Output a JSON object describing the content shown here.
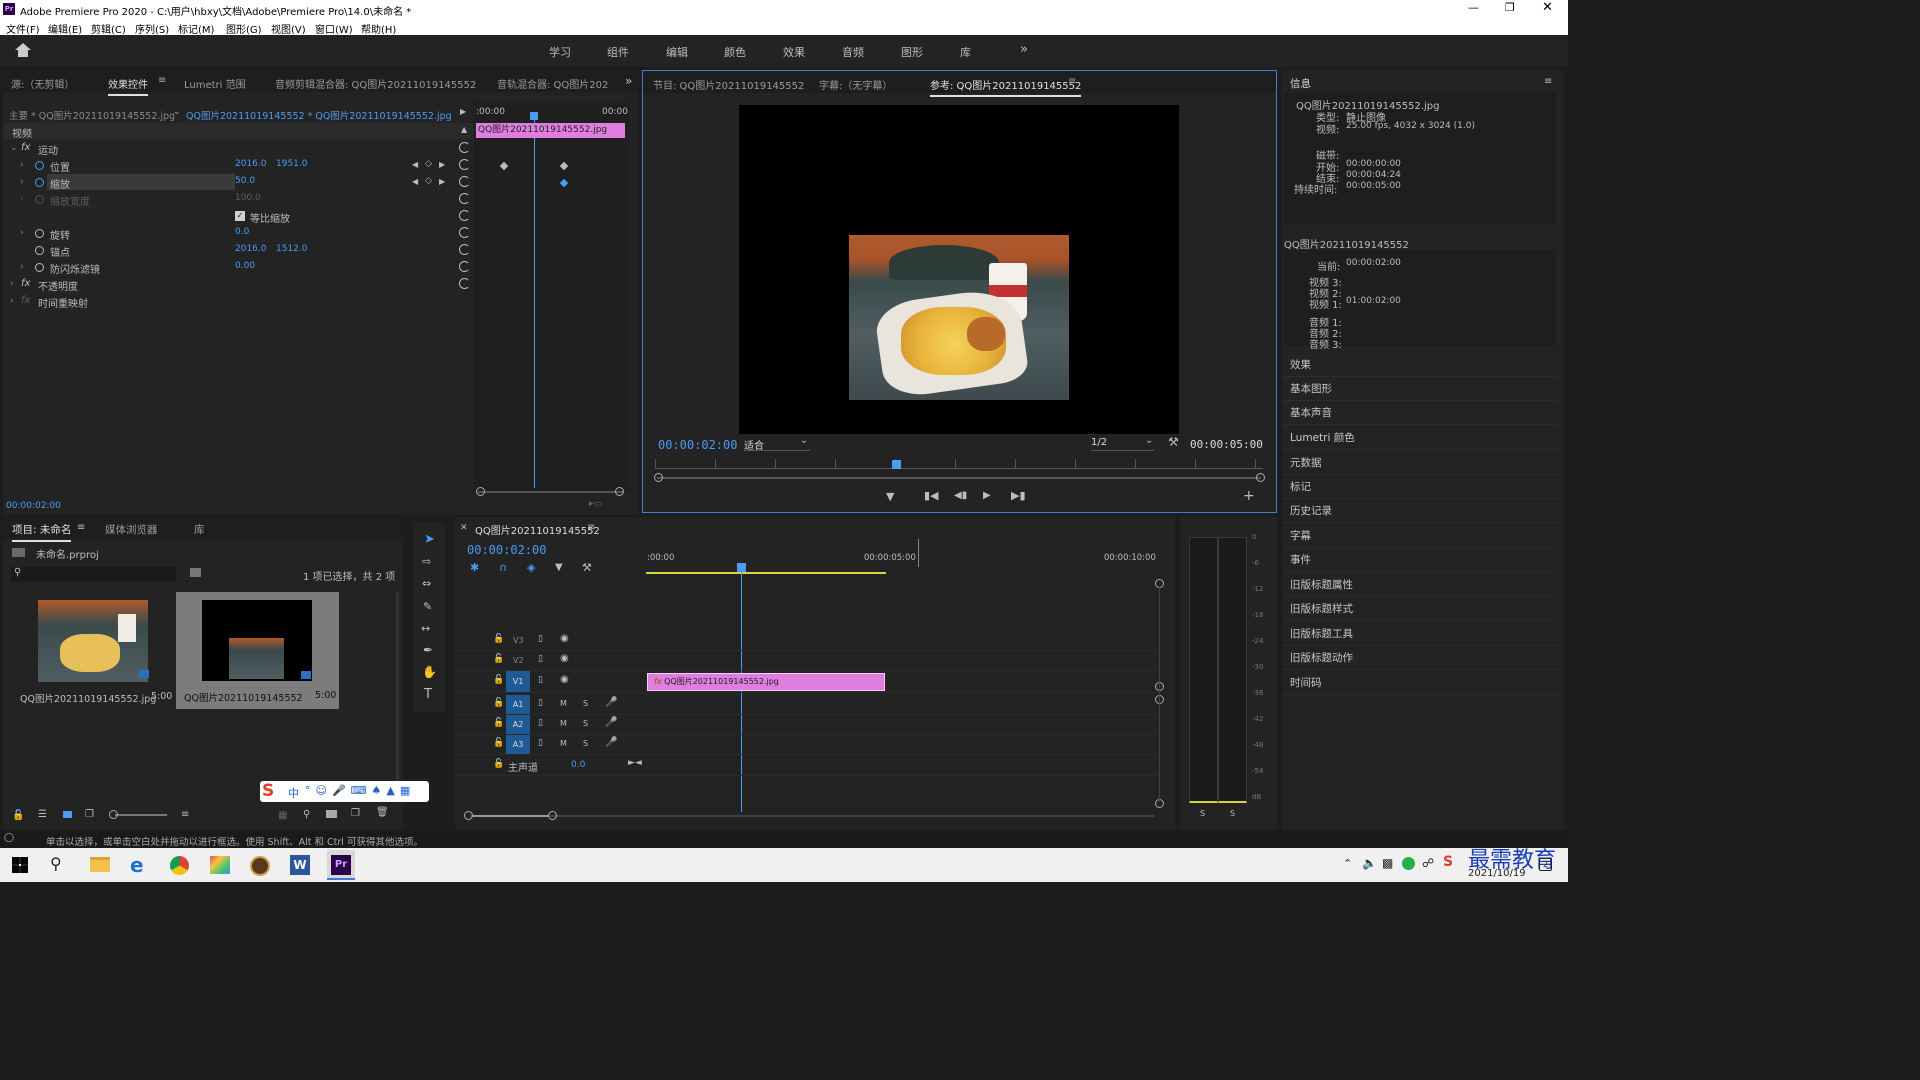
{
  "titlebar": {
    "title": "Adobe Premiere Pro 2020 - C:\\用户\\hbxy\\文档\\Adobe\\Premiere Pro\\14.0\\未命名 *",
    "logo": "Pr"
  },
  "menu": [
    "文件(F)",
    "编辑(E)",
    "剪辑(C)",
    "序列(S)",
    "标记(M)",
    "图形(G)",
    "视图(V)",
    "窗口(W)",
    "帮助(H)"
  ],
  "workspaces": [
    "学习",
    "组件",
    "编辑",
    "颜色",
    "效果",
    "音频",
    "图形",
    "库"
  ],
  "source_panel": {
    "tabs": [
      "源:（无剪辑）",
      "效果控件",
      "Lumetri 范围",
      "音频剪辑混合器: QQ图片20211019145552",
      "音轨混合器: QQ图片202"
    ],
    "active_tab": 1,
    "clip_master": "主要 * QQ图片20211019145552.jpg",
    "clip_seq": "QQ图片20211019145552 * QQ图片20211019145552.jpg",
    "mini_time_start": ":00:00",
    "mini_time_end": "00:00",
    "mini_clip": "QQ图片20211019145552.jpg",
    "section_video": "视频",
    "fx_motion": "运动",
    "position_label": "位置",
    "position_x": "2016.0",
    "position_y": "1951.0",
    "scale_label": "缩放",
    "scale_value": "50.0",
    "scale_width_label": "缩放宽度",
    "scale_width_value": "100.0",
    "uniform_label": "等比缩放",
    "rotation_label": "旋转",
    "rotation_value": "0.0",
    "anchor_label": "锚点",
    "anchor_x": "2016.0",
    "anchor_y": "1512.0",
    "flicker_label": "防闪烁滤镜",
    "flicker_value": "0.00",
    "opacity_label": "不透明度",
    "timeremap_label": "时间重映射",
    "timecode": "00:00:02:00"
  },
  "program_panel": {
    "tabs": [
      "节目: QQ图片20211019145552",
      "字幕:（无字幕）",
      "参考: QQ图片20211019145552"
    ],
    "active_tab": 2,
    "timecode": "00:00:02:00",
    "fit": "适合",
    "resolution": "1/2",
    "duration": "00:00:05:00"
  },
  "info_panel": {
    "title": "信息",
    "file": "QQ图片20211019145552.jpg",
    "type_label": "类型:",
    "type_value": "静止图像",
    "video_label": "视频:",
    "video_value": "25.00 fps, 4032 x 3024 (1.0)",
    "tape_label": "磁带:",
    "start_label": "开始:",
    "start_value": "00:00:00:00",
    "end_label": "结束:",
    "end_value": "00:00:04:24",
    "dur_label": "持续时间:",
    "dur_value": "00:00:05:00",
    "seq_title": "QQ图片20211019145552",
    "cur_label": "当前:",
    "cur_value": "00:00:02:00",
    "v3": "视频 3:",
    "v2": "视频 2:",
    "v1": "视频 1:",
    "v1_value": "01:00:02:00",
    "a1": "音频 1:",
    "a2": "音频 2:",
    "a3": "音频 3:"
  },
  "right_items": [
    "效果",
    "基本图形",
    "基本声音",
    "Lumetri 颜色",
    "元数据",
    "标记",
    "历史记录",
    "字幕",
    "事件",
    "旧版标题属性",
    "旧版标题样式",
    "旧版标题工具",
    "旧版标题动作",
    "时间码"
  ],
  "project_panel": {
    "tabs": [
      "项目: 未命名",
      "媒体浏览器",
      "库"
    ],
    "proj_file": "未命名.prproj",
    "selection": "1 项已选择，共 2 项",
    "items": [
      {
        "name": "QQ图片20211019145552.jpg",
        "dur": "5:00"
      },
      {
        "name": "QQ图片20211019145552",
        "dur": "5:00"
      }
    ]
  },
  "timeline": {
    "seq_name": "QQ图片20211019145552",
    "timecode": "00:00:02:00",
    "ruler": [
      ":00:00",
      "00:00:05:00",
      "00:00:10:00"
    ],
    "video_tracks": [
      "V3",
      "V2",
      "V1"
    ],
    "audio_tracks": [
      "A1",
      "A2",
      "A3"
    ],
    "master_label": "主声道",
    "master_value": "0.0",
    "clip_label": "QQ图片20211019145552.jpg",
    "m": "M",
    "s": "S"
  },
  "meter": {
    "labels": [
      "0",
      "-6",
      "-12",
      "-18",
      "-24",
      "-30",
      "-36",
      "-42",
      "-48",
      "-54",
      "dB"
    ],
    "solo": [
      "S",
      "S"
    ]
  },
  "statusbar": "单击以选择，或单击空白处并拖动以进行框选。使用 Shift、Alt 和 Ctrl 可获得其他选项。",
  "ime": {
    "label": "中"
  },
  "taskbar": {
    "date": "2021/10/19",
    "watermark": "最需教育",
    "badge": "2"
  },
  "colors": {
    "accent": "#4a9cf5",
    "clip": "#e07ee0",
    "work_area": "#d7d73a"
  }
}
